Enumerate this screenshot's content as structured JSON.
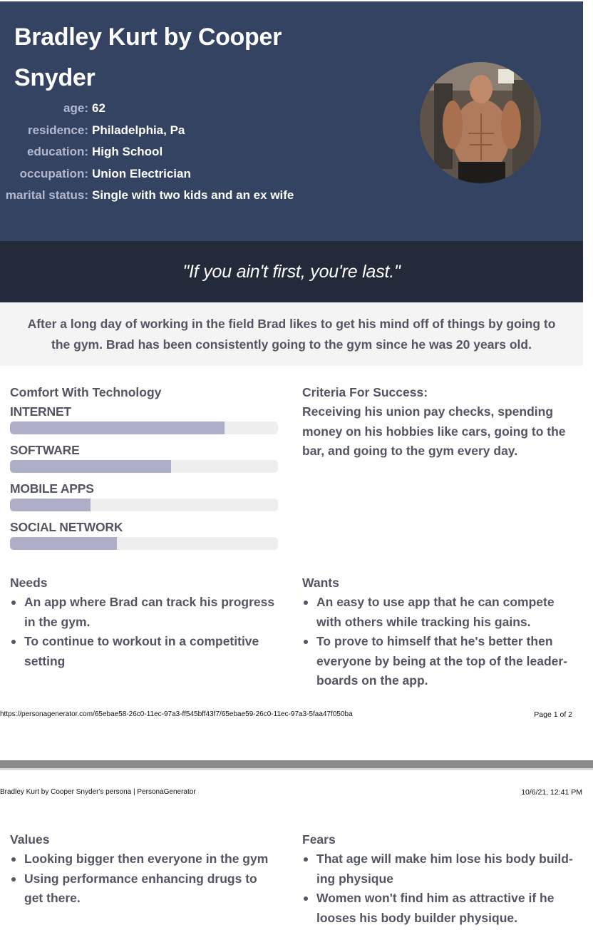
{
  "persona": {
    "title": "Bradley Kurt by Cooper Snyder",
    "fields": [
      {
        "label": "age:",
        "value": "62"
      },
      {
        "label": "residence:",
        "value": "Philadelphia, Pa"
      },
      {
        "label": "education:",
        "value": "High School"
      },
      {
        "label": "occupation:",
        "value": "Union Electrician"
      },
      {
        "label": "marital status:",
        "value": "Single with two kids and an ex wife"
      }
    ],
    "quote": "\"If you ain't first, you're last.\"",
    "summary": "After a long day of working in the field Brad likes to get his mind off of things by going to the gym. Brad has been consistently going to the gym since he was 20 years old."
  },
  "technology": {
    "title": "Comfort With Technology",
    "bars": [
      {
        "label": "INTERNET",
        "level": 0.8
      },
      {
        "label": "SOFTWARE",
        "level": 0.6
      },
      {
        "label": "MOBILE APPS",
        "level": 0.3
      },
      {
        "label": "SOCIAL NETWORK",
        "level": 0.4
      }
    ]
  },
  "criteria": {
    "title": "Criteria For Success:",
    "text": "Receiving his union pay checks, spending money on his hobbies like cars, going to the bar, and going to the gym every day."
  },
  "needs": {
    "title": "Needs",
    "items": [
      "An app where Brad can track his progress in the gym.",
      "To continue to workout in a competitive setting"
    ]
  },
  "wants": {
    "title": "Wants",
    "items": [
      "An easy to use app that he can compete with others while tracking his gains.",
      "To prove to himself that he's better then everyone by being at the top of the leader-boards on the app."
    ]
  },
  "footer": {
    "url": "https://personagenerator.com/65ebae58-26c0-11ec-97a3-ff545bff43f7/65ebae59-26c0-11ec-97a3-5faa47f050ba",
    "page": "Page 1 of 2"
  },
  "page2_header": {
    "left": "Bradley Kurt by Cooper Snyder's persona | PersonaGenerator",
    "right": "10/6/21, 12:41 PM"
  },
  "values": {
    "title": "Values",
    "items": [
      "Looking bigger then everyone in the gym",
      "Using performance enhancing drugs to get there."
    ]
  },
  "fears": {
    "title": "Fears",
    "items": [
      "That age will make him lose his body build-ing physique",
      "Women won't find him as attractive if he looses his body builder physique."
    ]
  },
  "colors": {
    "header_bg": "#334361",
    "quote_bg": "#232b3b",
    "label_color": "#b3b8d1",
    "bar_fill": "#aeaec8",
    "bar_track": "#eeeeee",
    "text": "#535562"
  }
}
